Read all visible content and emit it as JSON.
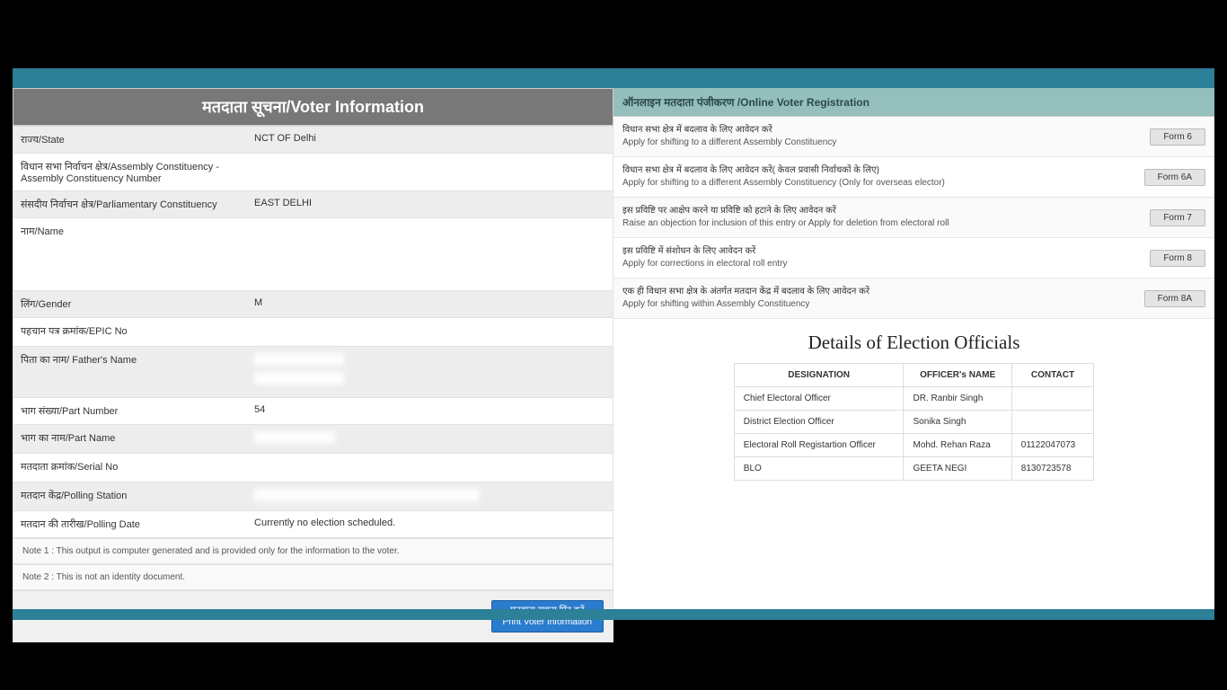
{
  "voter_info": {
    "title": "मतदाता सूचना/Voter Information",
    "rows": {
      "state_label": "राज्य/State",
      "state_value": "NCT OF Delhi",
      "ac_label": "विधान सभा निर्वाचन क्षेत्र/Assembly Constituency - Assembly Constituency Number",
      "pc_label": "संसदीय निर्वाचन क्षेत्र/Parliamentary Constituency",
      "pc_value": "EAST DELHI",
      "name_label": "नाम/Name",
      "gender_label": "लिंग/Gender",
      "gender_value": "M",
      "epic_label": "पहचान पत्र क्रमांक/EPIC No",
      "father_label": "पिता का नाम/ Father's Name",
      "part_no_label": "भाग संख्या/Part Number",
      "part_no_value": "54",
      "part_name_label": "भाग का नाम/Part Name",
      "serial_label": "मतदाता क्रमांक/Serial No",
      "polling_station_label": "मतदान केंद्र/Polling Station",
      "polling_date_label": "मतदान की तारीख/Polling Date",
      "polling_date_value": "Currently no election scheduled."
    },
    "note1": "Note 1 : This output is computer generated and is provided only for the information to the voter.",
    "note2": "Note 2 : This is not an identity document.",
    "print_hi": "मतदाता सूचना प्रिंट करें",
    "print_en": "Print Voter Information"
  },
  "registration": {
    "header": "ऑनलाइन मतदाता पंजीकरण /Online Voter Registration",
    "items": [
      {
        "hi": "विधान सभा क्षेत्र में बदलाव के लिए आवेदन करें",
        "en": "Apply for shifting to a different Assembly Constituency",
        "btn": "Form 6"
      },
      {
        "hi": "विधान सभा क्षेत्र में बदलाव के लिए आवेदन करें( केवल प्रवासी निर्वाचकों के लिए)",
        "en": "Apply for shifting to a different Assembly Constituency (Only for overseas elector)",
        "btn": "Form 6A"
      },
      {
        "hi": "इस प्रविष्टि पर आक्षेप करने या प्रविष्टि को हटाने के लिए आवेदन करें",
        "en": "Raise an objection for inclusion of this entry or Apply for deletion from electoral roll",
        "btn": "Form 7"
      },
      {
        "hi": "इस प्रविष्टि में संशोधन के लिए आवेदन करें",
        "en": "Apply for corrections in electoral roll entry",
        "btn": "Form 8"
      },
      {
        "hi": "एक ही विधान सभा क्षेत्र के अंतर्गत मतदान केंद्र में बदलाव के लिए आवेदन करें",
        "en": "Apply for shifting within Assembly Constituency",
        "btn": "Form 8A"
      }
    ]
  },
  "officials": {
    "title": "Details of Election Officials",
    "headers": {
      "designation": "DESIGNATION",
      "name": "OFFICER's NAME",
      "contact": "CONTACT"
    },
    "rows": [
      {
        "designation": "Chief Electoral Officer",
        "name": "DR. Ranbir Singh",
        "contact": ""
      },
      {
        "designation": "District Election Officer",
        "name": "Sonika Singh",
        "contact": ""
      },
      {
        "designation": "Electoral Roll Registartion Officer",
        "name": "Mohd. Rehan Raza",
        "contact": "01122047073"
      },
      {
        "designation": "BLO",
        "name": "GEETA NEGI",
        "contact": "8130723578"
      }
    ]
  }
}
